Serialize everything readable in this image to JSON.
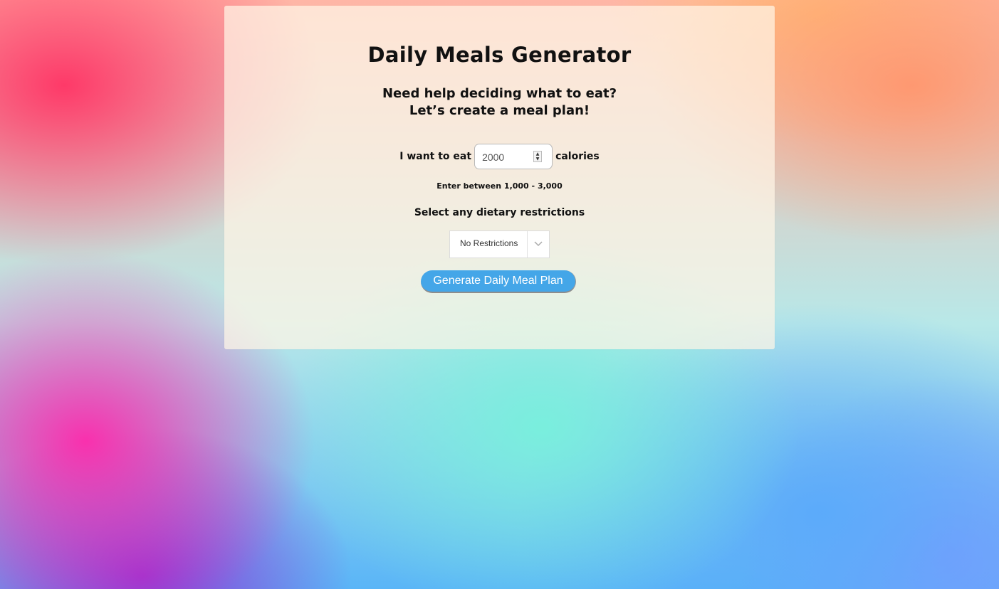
{
  "header": {
    "title": "Daily Meals Generator",
    "subtitle_line1": "Need help deciding what to eat?",
    "subtitle_line2": "Let’s create a meal plan!"
  },
  "calories": {
    "prefix": "I want to eat",
    "value": "2000",
    "suffix": "calories",
    "hint": "Enter between 1,000 - 3,000"
  },
  "dietary": {
    "label": "Select any dietary restrictions",
    "selected": "No Restrictions"
  },
  "actions": {
    "generate_label": "Generate Daily Meal Plan"
  },
  "colors": {
    "button": "#44a6e8",
    "text": "#111111"
  }
}
